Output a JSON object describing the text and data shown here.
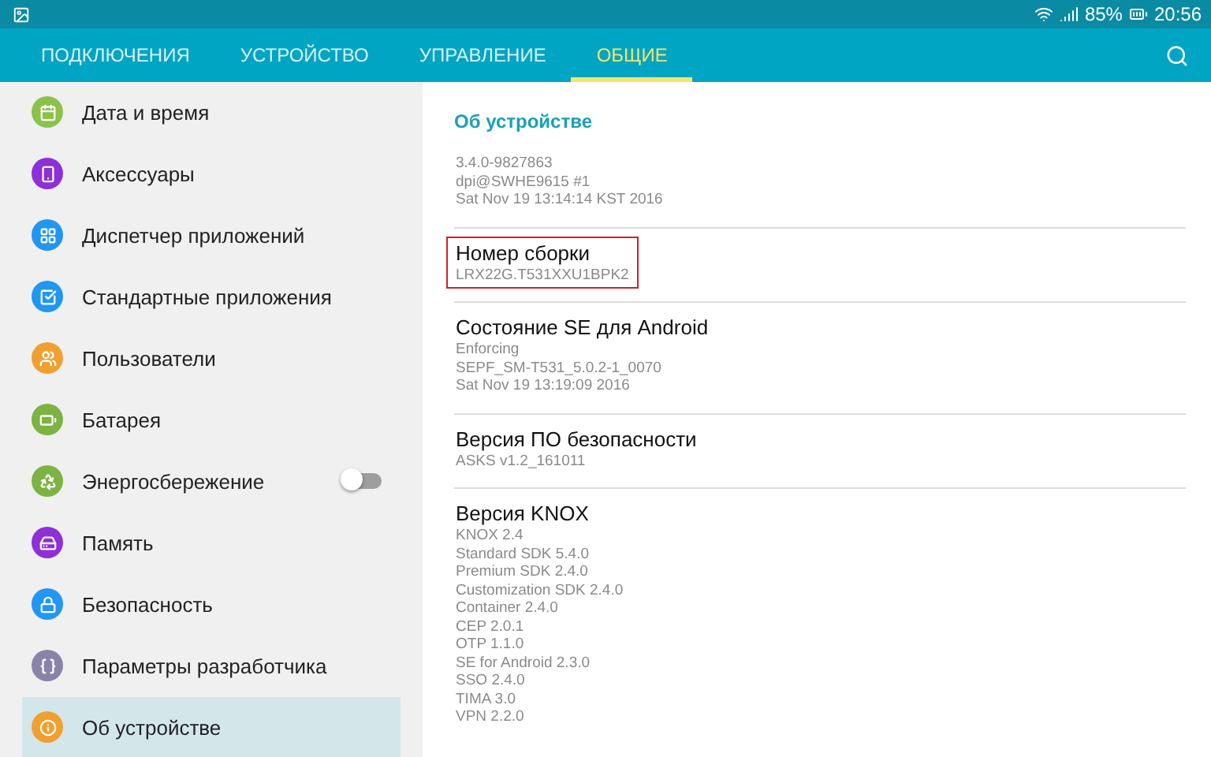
{
  "status_bar": {
    "battery": "85%",
    "time": "20:56"
  },
  "tabs": [
    {
      "label": "ПОДКЛЮЧЕНИЯ",
      "selected": false
    },
    {
      "label": "УСТРОЙСТВО",
      "selected": false
    },
    {
      "label": "УПРАВЛЕНИЕ",
      "selected": false
    },
    {
      "label": "ОБЩИЕ",
      "selected": true
    }
  ],
  "sidebar": {
    "items": [
      {
        "label": "Дата и время",
        "color": "#8bc34a",
        "kind": "link",
        "selected": false
      },
      {
        "label": "Аксессуары",
        "color": "#8e2fd8",
        "kind": "link",
        "selected": false
      },
      {
        "label": "Диспетчер приложений",
        "color": "#2196f3",
        "kind": "link",
        "selected": false
      },
      {
        "label": "Стандартные приложения",
        "color": "#2196f3",
        "kind": "link",
        "selected": false
      },
      {
        "label": "Пользователи",
        "color": "#f0a030",
        "kind": "link",
        "selected": false
      },
      {
        "label": "Батарея",
        "color": "#7cb342",
        "kind": "link",
        "selected": false
      },
      {
        "label": "Энергосбережение",
        "color": "#7cb342",
        "kind": "toggle",
        "on": false,
        "selected": false
      },
      {
        "label": "Память",
        "color": "#8e2fd8",
        "kind": "link",
        "selected": false
      },
      {
        "label": "Безопасность",
        "color": "#2196f3",
        "kind": "link",
        "selected": false
      },
      {
        "label": "Параметры разработчика",
        "color": "#8a83a8",
        "kind": "link",
        "selected": false
      },
      {
        "label": "Об устройстве",
        "color": "#f0a030",
        "kind": "link",
        "selected": true
      }
    ]
  },
  "detail": {
    "heading": "Об устройстве",
    "sections": [
      {
        "lines": [
          "3.4.0-9827863",
          "dpi@SWHE9615 #1",
          "Sat Nov 19 13:14:14 KST 2016"
        ],
        "highlighted": false
      },
      {
        "title": "Номер сборки",
        "lines": [
          "LRX22G.T531XXU1BPK2"
        ],
        "highlighted": true
      },
      {
        "title": "Состояние SE для Android",
        "lines": [
          "Enforcing",
          "SEPF_SM-T531_5.0.2-1_0070",
          "Sat Nov 19 13:19:09 2016"
        ],
        "highlighted": false
      },
      {
        "title": "Версия ПО безопасности",
        "lines": [
          "ASKS v1.2_161011"
        ],
        "highlighted": false
      },
      {
        "title": "Версия KNOX",
        "lines": [
          "KNOX 2.4",
          "Standard SDK 5.4.0",
          "Premium SDK 2.4.0",
          "Customization SDK 2.4.0",
          "Container 2.4.0",
          "CEP 2.0.1",
          "OTP 1.1.0",
          "SE for Android 2.3.0",
          "SSO 2.4.0",
          "TIMA 3.0",
          "VPN 2.2.0"
        ],
        "highlighted": false
      }
    ]
  }
}
